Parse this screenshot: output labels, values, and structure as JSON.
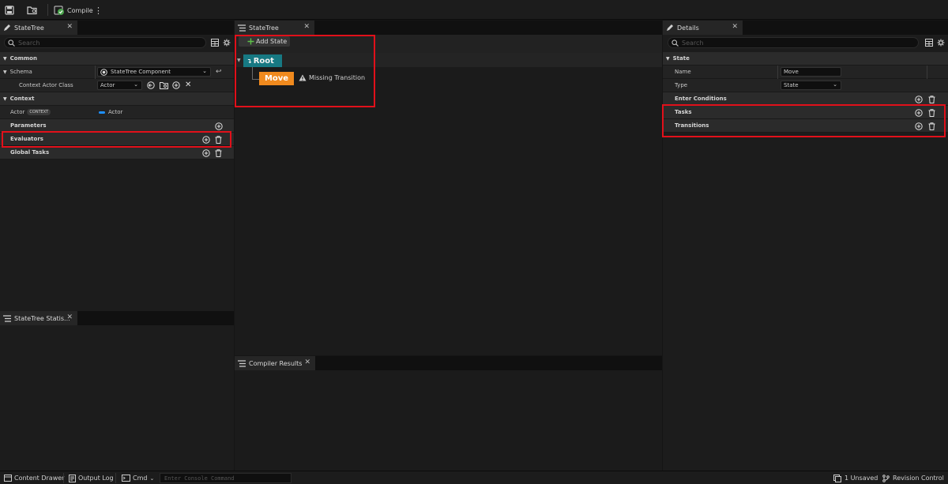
{
  "toolbar": {
    "compile_label": "Compile"
  },
  "left_panel": {
    "tab_title": "StateTree",
    "search_placeholder": "Search",
    "sections": {
      "common": "Common",
      "context": "Context"
    },
    "schema_label": "Schema",
    "schema_value": "StateTree Component",
    "context_actor_class_label": "Context Actor Class",
    "context_actor_class_value": "Actor",
    "actor_label": "Actor",
    "context_badge": "CONTEXT",
    "actor_value": "Actor",
    "parameters_label": "Parameters",
    "evaluators_label": "Evaluators",
    "global_tasks_label": "Global Tasks"
  },
  "statistics_panel": {
    "tab_title": "StateTree Statis..."
  },
  "center_panel": {
    "tab_title": "StateTree",
    "add_state_label": "Add State",
    "root_label": "Root",
    "move_label": "Move",
    "warning_text": "Missing Transition"
  },
  "compiler_panel": {
    "tab_title": "Compiler Results"
  },
  "details_panel": {
    "tab_title": "Details",
    "search_placeholder": "Search",
    "section_state": "State",
    "name_label": "Name",
    "name_value": "Move",
    "type_label": "Type",
    "type_value": "State",
    "enter_conditions_label": "Enter Conditions",
    "tasks_label": "Tasks",
    "transitions_label": "Transitions"
  },
  "status_bar": {
    "content_drawer": "Content Drawer",
    "output_log": "Output Log",
    "cmd_label": "Cmd",
    "console_placeholder": "Enter Console Command",
    "unsaved": "1 Unsaved",
    "revision_control": "Revision Control"
  },
  "colors": {
    "root_state": "#177983",
    "move_state": "#f08a1e",
    "highlight": "#e1101a",
    "compile_ok": "#49a34b"
  }
}
